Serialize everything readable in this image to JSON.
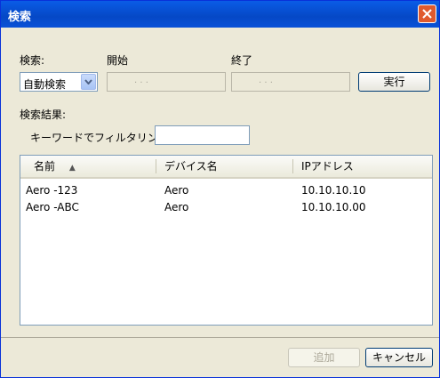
{
  "window": {
    "title": "検索"
  },
  "search": {
    "mode_label": "検索:",
    "mode_value": "自動検索",
    "start_label": "開始",
    "end_label": "終了",
    "date_placeholder": ".   .   .",
    "run_button": "実行"
  },
  "results": {
    "label": "検索結果:",
    "filter_label": "キーワードでフィルタリング:",
    "filter_value": "",
    "columns": [
      "名前",
      "デバイス名",
      "IPアドレス"
    ],
    "sort_indicator": "▲",
    "rows": [
      {
        "name": "Aero -123",
        "device": "Aero",
        "ip": "10.10.10.10"
      },
      {
        "name": "Aero -ABC",
        "device": "Aero",
        "ip": "10.10.10.00"
      }
    ]
  },
  "footer": {
    "add_button": "追加",
    "cancel_button": "キャンセル"
  }
}
